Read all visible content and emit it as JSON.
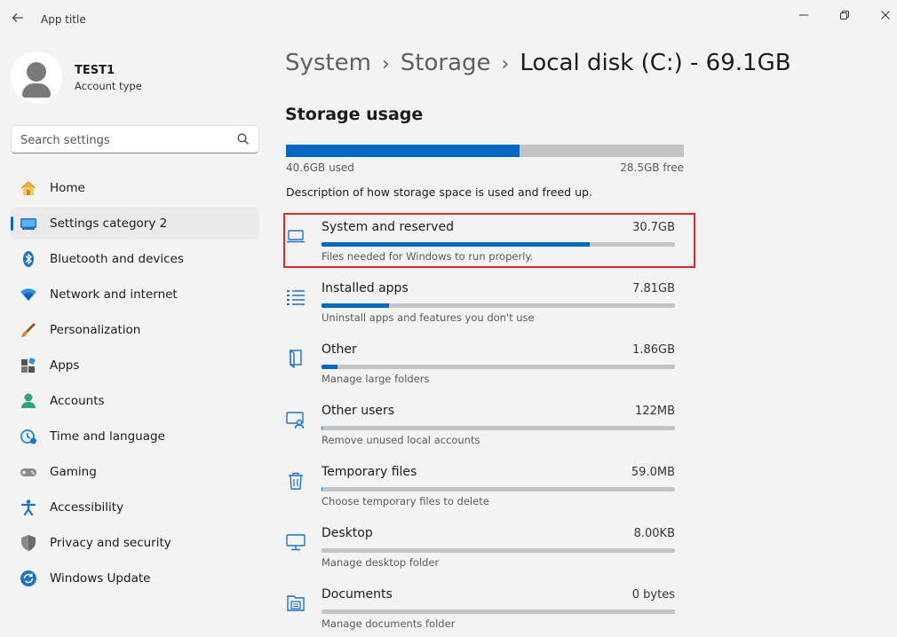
{
  "window": {
    "title": "App title"
  },
  "profile": {
    "name": "TEST1",
    "subtitle": "Account type"
  },
  "search": {
    "placeholder": "Search settings"
  },
  "colors": {
    "accent": "#0067c0",
    "highlight_outline": "#d92b2b",
    "bar_track": "#c4c4c4"
  },
  "nav": {
    "items": [
      {
        "label": "Home",
        "icon": "home-icon",
        "active": false
      },
      {
        "label": "Settings category 2",
        "icon": "laptop-icon",
        "active": true
      },
      {
        "label": "Bluetooth and devices",
        "icon": "bluetooth-icon",
        "active": false
      },
      {
        "label": "Network and internet",
        "icon": "wifi-icon",
        "active": false
      },
      {
        "label": "Personalization",
        "icon": "brush-icon",
        "active": false
      },
      {
        "label": "Apps",
        "icon": "apps-icon",
        "active": false
      },
      {
        "label": "Accounts",
        "icon": "person-icon",
        "active": false
      },
      {
        "label": "Time and language",
        "icon": "clock-globe-icon",
        "active": false
      },
      {
        "label": "Gaming",
        "icon": "gamepad-icon",
        "active": false
      },
      {
        "label": "Accessibility",
        "icon": "accessibility-icon",
        "active": false
      },
      {
        "label": "Privacy and security",
        "icon": "shield-icon",
        "active": false
      },
      {
        "label": "Windows Update",
        "icon": "update-icon",
        "active": false
      }
    ]
  },
  "breadcrumb": {
    "level1": "System",
    "level2": "Storage",
    "current": "Local disk (C:) - 69.1GB"
  },
  "storage": {
    "title": "Storage usage",
    "used": "40.6GB used",
    "free": "28.5GB free",
    "used_fraction": 0.588,
    "description": "Description of how storage space is used and freed up."
  },
  "categories": [
    {
      "name": "System and reserved",
      "size": "30.7GB",
      "fraction": 0.76,
      "description": "Files needed for Windows to run properly.",
      "icon": "laptop-icon",
      "highlighted": true
    },
    {
      "name": "Installed apps",
      "size": "7.81GB",
      "fraction": 0.19,
      "description": "Uninstall apps and features you don't use",
      "icon": "list-icon",
      "highlighted": false
    },
    {
      "name": "Other",
      "size": "1.86GB",
      "fraction": 0.045,
      "description": "Manage large folders",
      "icon": "book-icon",
      "highlighted": false
    },
    {
      "name": "Other users",
      "size": "122MB",
      "fraction": 0.003,
      "description": "Remove unused local accounts",
      "icon": "person-screen-icon",
      "highlighted": false
    },
    {
      "name": "Temporary files",
      "size": "59.0MB",
      "fraction": 0.0015,
      "description": "Choose temporary files to delete",
      "icon": "trash-icon",
      "highlighted": false
    },
    {
      "name": "Desktop",
      "size": "8.00KB",
      "fraction": 0.0,
      "description": "Manage desktop folder",
      "icon": "monitor-icon",
      "highlighted": false
    },
    {
      "name": "Documents",
      "size": "0 bytes",
      "fraction": 0.0,
      "description": "Manage documents folder",
      "icon": "documents-icon",
      "highlighted": false
    }
  ]
}
